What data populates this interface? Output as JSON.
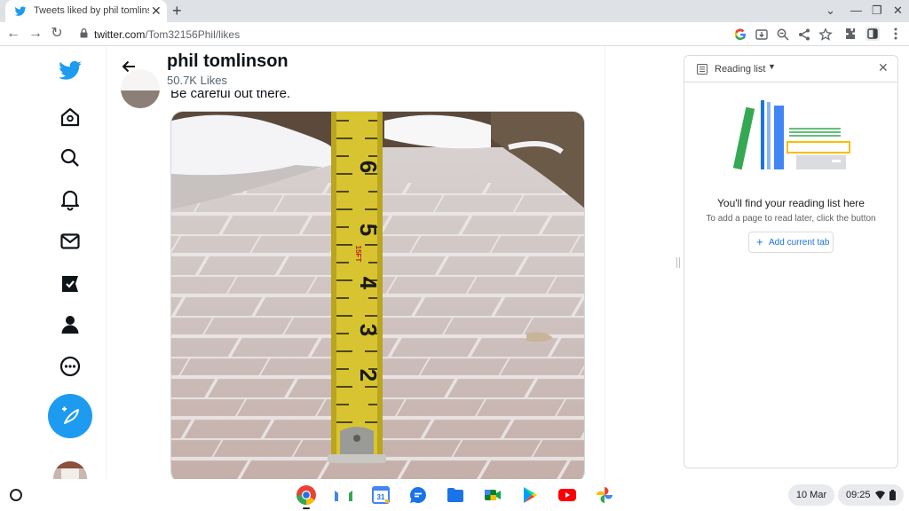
{
  "browser": {
    "tab": {
      "title": "Tweets liked by phil tomlinson (@",
      "close": "✕"
    },
    "new_tab": "+",
    "window_controls": {
      "dropdown": "⌄",
      "minimize": "—",
      "maximize": "❐",
      "close": "✕"
    },
    "nav": {
      "back": "←",
      "forward": "→",
      "reload": "↻"
    },
    "url": {
      "host": "twitter.com",
      "path": "/Tom32156Phil/likes"
    }
  },
  "twitter": {
    "header": {
      "name": "phil tomlinson",
      "subtitle": "50.7K Likes"
    },
    "tweet": {
      "text": "Be careful out there."
    },
    "nav_icons": [
      "twitter-logo",
      "home-icon",
      "search-icon",
      "notifications-icon",
      "messages-icon",
      "verified-icon",
      "profile-icon",
      "more-icon"
    ],
    "accent_color": "#1d9bf0",
    "photo": {
      "tape_numbers": [
        "6",
        "5",
        "4",
        "3",
        "2"
      ],
      "tape_mark": "15FT"
    }
  },
  "reading_list": {
    "title": "Reading list",
    "caret": "▼",
    "close": "✕",
    "heading": "You'll find your reading list here",
    "subtext": "To add a page to read later, click the button",
    "add_button": {
      "plus": "+",
      "label": "Add current tab"
    }
  },
  "shelf": {
    "apps": [
      "chrome-icon",
      "gmail-icon",
      "calendar-icon",
      "chat-icon",
      "files-icon",
      "meet-icon",
      "play-store-icon",
      "youtube-icon",
      "photos-icon"
    ],
    "date": "10 Mar",
    "time": "09:25"
  }
}
